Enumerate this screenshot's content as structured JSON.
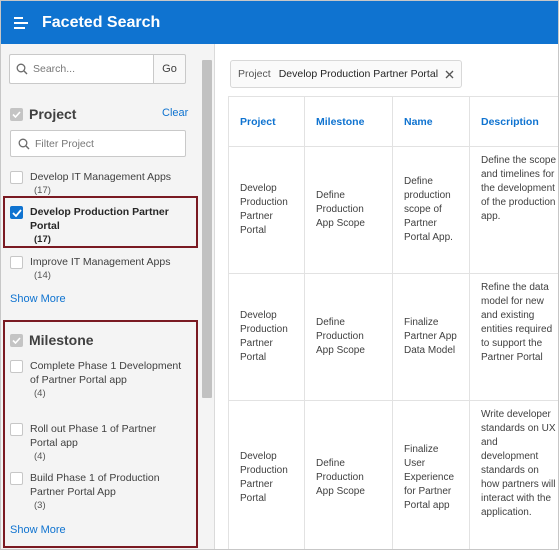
{
  "header": {
    "title": "Faceted Search"
  },
  "sidebar": {
    "search": {
      "placeholder": "Search...",
      "go_label": "Go"
    },
    "project_facet": {
      "title": "Project",
      "clear_label": "Clear",
      "filter_placeholder": "Filter Project",
      "items": [
        {
          "label": "Develop IT Management Apps",
          "count": "(17)",
          "checked": false
        },
        {
          "label": "Develop Production Partner Portal",
          "count": "(17)",
          "checked": true
        },
        {
          "label": "Improve IT Management Apps",
          "count": "(14)",
          "checked": false
        }
      ],
      "show_more": "Show More"
    },
    "milestone_facet": {
      "title": "Milestone",
      "items": [
        {
          "label": "Complete Phase 1 Development of Partner Portal app",
          "count": "(4)",
          "checked": false
        },
        {
          "label": "Roll out Phase 1 of Partner Portal app",
          "count": "(4)",
          "checked": false
        },
        {
          "label": "Build Phase 1 of Production Partner Portal App",
          "count": "(3)",
          "checked": false
        }
      ],
      "show_more": "Show More"
    }
  },
  "main": {
    "filter_chip": {
      "label": "Project",
      "value": "Develop Production Partner Portal"
    },
    "table": {
      "columns": [
        "Project",
        "Milestone",
        "Name",
        "Description"
      ],
      "rows": [
        {
          "project": "Develop Production Partner Portal",
          "milestone": "Define Production App Scope",
          "name": "Define production scope of Partner Portal App.",
          "description": "Define the scope and timelines for the development of the production app."
        },
        {
          "project": "Develop Production Partner Portal",
          "milestone": "Define Production App Scope",
          "name": "Finalize Partner App Data Model",
          "description": "Refine the data model for new and existing entities required to support the Partner Portal"
        },
        {
          "project": "Develop Production Partner Portal",
          "milestone": "Define Production App Scope",
          "name": "Finalize User Experience for Partner Portal app",
          "description": "Write developer standards on UX and development standards on how partners will interact with the application."
        }
      ]
    }
  },
  "colors": {
    "header_bg": "#0f73d0",
    "link": "#0f73d0",
    "highlight_border": "#7a1a22"
  }
}
